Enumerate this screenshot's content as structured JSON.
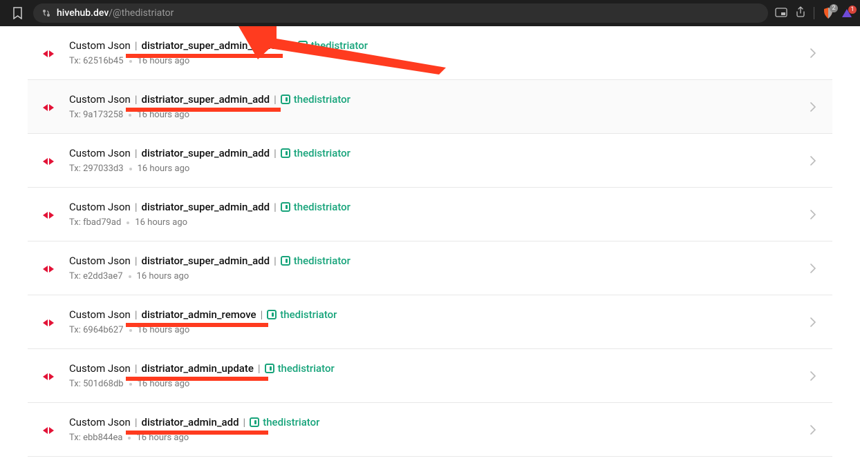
{
  "browser": {
    "host": "hivehub.dev",
    "path": "/@thedistriator",
    "shield_badge": "2",
    "tri_badge": "1"
  },
  "rows": [
    {
      "op_type": "Custom Json",
      "op_name": "distriator_super_admin_remove",
      "user": "thedistriator",
      "tx_label": "Tx: 62516b45",
      "time": "16 hours ago",
      "hl": false,
      "underline": true,
      "uwidth": 227
    },
    {
      "op_type": "Custom Json",
      "op_name": "distriator_super_admin_add",
      "user": "thedistriator",
      "tx_label": "Tx: 9a173258",
      "time": "16 hours ago",
      "hl": true,
      "underline": true,
      "uwidth": 224
    },
    {
      "op_type": "Custom Json",
      "op_name": "distriator_super_admin_add",
      "user": "thedistriator",
      "tx_label": "Tx: 297033d3",
      "time": "16 hours ago",
      "hl": false,
      "underline": false,
      "uwidth": 0
    },
    {
      "op_type": "Custom Json",
      "op_name": "distriator_super_admin_add",
      "user": "thedistriator",
      "tx_label": "Tx: fbad79ad",
      "time": "16 hours ago",
      "hl": false,
      "underline": false,
      "uwidth": 0
    },
    {
      "op_type": "Custom Json",
      "op_name": "distriator_super_admin_add",
      "user": "thedistriator",
      "tx_label": "Tx: e2dd3ae7",
      "time": "16 hours ago",
      "hl": false,
      "underline": false,
      "uwidth": 0
    },
    {
      "op_type": "Custom Json",
      "op_name": "distriator_admin_remove",
      "user": "thedistriator",
      "tx_label": "Tx: 6964b627",
      "time": "16 hours ago",
      "hl": false,
      "underline": true,
      "uwidth": 206
    },
    {
      "op_type": "Custom Json",
      "op_name": "distriator_admin_update",
      "user": "thedistriator",
      "tx_label": "Tx: 501d68db",
      "time": "16 hours ago",
      "hl": false,
      "underline": true,
      "uwidth": 206
    },
    {
      "op_type": "Custom Json",
      "op_name": "distriator_admin_add",
      "user": "thedistriator",
      "tx_label": "Tx: ebb844ea",
      "time": "16 hours ago",
      "hl": false,
      "underline": true,
      "uwidth": 206
    }
  ]
}
